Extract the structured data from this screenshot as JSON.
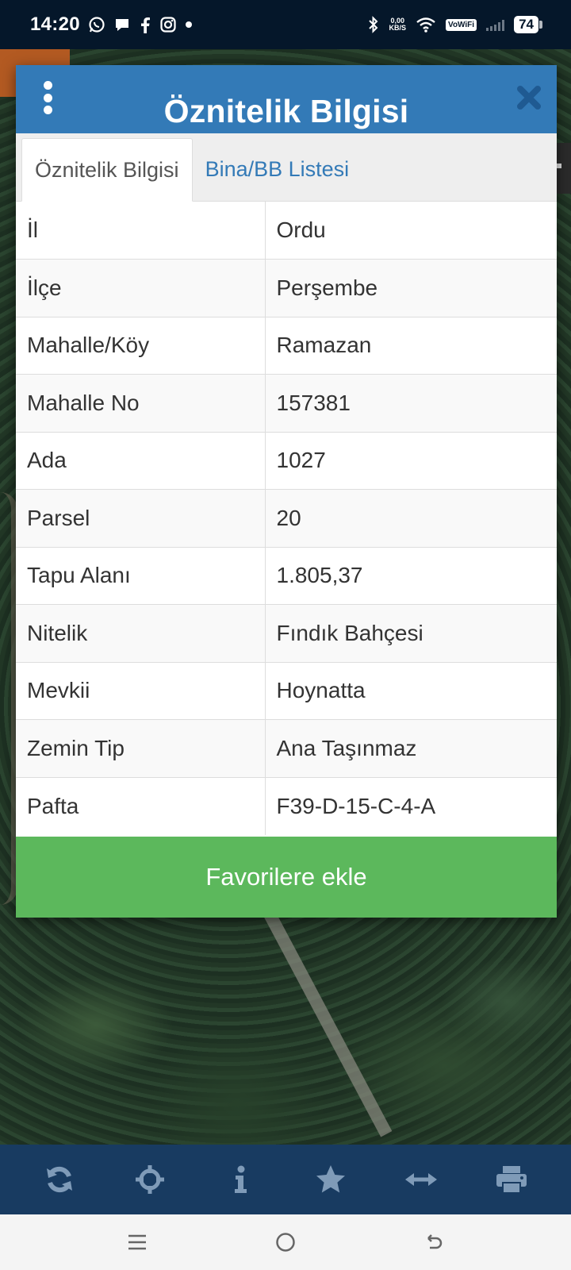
{
  "status_bar": {
    "time": "14:20",
    "net_speed_value": "0,00",
    "net_speed_unit": "KB/S",
    "vowifi_label": "VoWiFi",
    "battery": "74"
  },
  "dialog": {
    "title": "Öznitelik Bilgisi",
    "tabs": [
      {
        "label": "Öznitelik Bilgisi",
        "active": true
      },
      {
        "label": "Bina/BB Listesi",
        "active": false
      }
    ],
    "rows": [
      {
        "key": "İl",
        "value": "Ordu"
      },
      {
        "key": "İlçe",
        "value": "Perşembe"
      },
      {
        "key": "Mahalle/Köy",
        "value": "Ramazan"
      },
      {
        "key": "Mahalle No",
        "value": "157381"
      },
      {
        "key": "Ada",
        "value": "1027"
      },
      {
        "key": "Parsel",
        "value": "20"
      },
      {
        "key": "Tapu Alanı",
        "value": "1.805,37"
      },
      {
        "key": "Nitelik",
        "value": "Fındık Bahçesi"
      },
      {
        "key": "Mevkii",
        "value": "Hoynatta"
      },
      {
        "key": "Zemin Tip",
        "value": "Ana Taşınmaz"
      },
      {
        "key": "Pafta",
        "value": "F39-D-15-C-4-A"
      }
    ],
    "favorite_button_label": "Favorilere ekle"
  },
  "toolbar": {
    "icons": [
      "refresh-icon",
      "crosshair-icon",
      "info-icon",
      "star-icon",
      "measure-arrows-icon",
      "print-icon"
    ]
  },
  "navigation": {
    "icons": [
      "recent-apps-icon",
      "home-icon",
      "back-icon"
    ]
  },
  "colors": {
    "header_blue": "#337ab7",
    "button_green": "#5cb85c",
    "toolbar_navy": "#183b61",
    "status_bar": "#05172a",
    "toolbar_icon": "#7f9bb8"
  }
}
